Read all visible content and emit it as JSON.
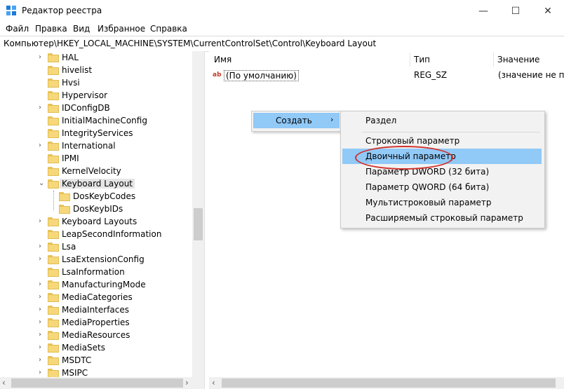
{
  "window": {
    "title": "Редактор реестра",
    "minimize": "—",
    "maximize": "☐",
    "close": "✕"
  },
  "menu": [
    "Файл",
    "Правка",
    "Вид",
    "Избранное",
    "Справка"
  ],
  "address": "Компьютер\\HKEY_LOCAL_MACHINE\\SYSTEM\\CurrentControlSet\\Control\\Keyboard Layout",
  "tree": [
    {
      "label": "HAL",
      "expander": "›"
    },
    {
      "label": "hivelist",
      "expander": ""
    },
    {
      "label": "Hvsi",
      "expander": ""
    },
    {
      "label": "Hypervisor",
      "expander": ""
    },
    {
      "label": "IDConfigDB",
      "expander": "›"
    },
    {
      "label": "InitialMachineConfig",
      "expander": ""
    },
    {
      "label": "IntegrityServices",
      "expander": ""
    },
    {
      "label": "International",
      "expander": "›"
    },
    {
      "label": "IPMI",
      "expander": ""
    },
    {
      "label": "KernelVelocity",
      "expander": ""
    },
    {
      "label": "Keyboard Layout",
      "expander": "⌄",
      "selected": true
    },
    {
      "label": "DosKeybCodes",
      "expander": "",
      "child": true
    },
    {
      "label": "DosKeybIDs",
      "expander": "",
      "child": true
    },
    {
      "label": "Keyboard Layouts",
      "expander": "›"
    },
    {
      "label": "LeapSecondInformation",
      "expander": ""
    },
    {
      "label": "Lsa",
      "expander": "›"
    },
    {
      "label": "LsaExtensionConfig",
      "expander": "›"
    },
    {
      "label": "LsaInformation",
      "expander": ""
    },
    {
      "label": "ManufacturingMode",
      "expander": "›"
    },
    {
      "label": "MediaCategories",
      "expander": "›"
    },
    {
      "label": "MediaInterfaces",
      "expander": "›"
    },
    {
      "label": "MediaProperties",
      "expander": "›"
    },
    {
      "label": "MediaResources",
      "expander": "›"
    },
    {
      "label": "MediaSets",
      "expander": "›"
    },
    {
      "label": "MSDTC",
      "expander": "›"
    },
    {
      "label": "MSIPC",
      "expander": "›"
    }
  ],
  "columns": {
    "name": "Имя",
    "type": "Тип",
    "value": "Значение"
  },
  "values": [
    {
      "icon": "ab",
      "name": "(По умолчанию)",
      "type": "REG_SZ",
      "data": "(значение не при"
    }
  ],
  "context_menu": {
    "create": "Создать",
    "arrow": "›"
  },
  "submenu": {
    "items": [
      "Раздел",
      "Строковый параметр",
      "Двоичный параметр",
      "Параметр DWORD (32 бита)",
      "Параметр QWORD (64 бита)",
      "Мультистроковый параметр",
      "Расширяемый строковый параметр"
    ],
    "highlighted_index": 2
  },
  "scroll_arrows": {
    "left": "‹",
    "right": "›"
  },
  "colors": {
    "highlight": "#91c9f7",
    "annotation": "#d0302a",
    "folder": "#f6d77a"
  }
}
